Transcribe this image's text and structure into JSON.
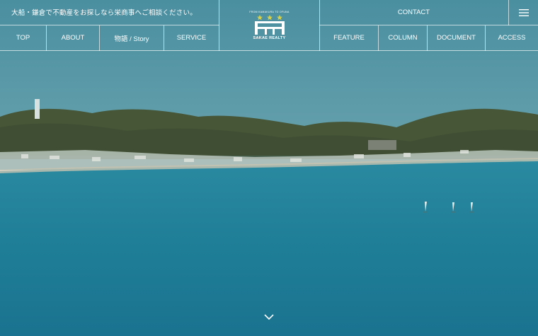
{
  "header": {
    "tagline": "大船・鎌倉で不動産をお探しなら栄商事へご相談ください。",
    "contact_label": "CONTACT",
    "nav_left": [
      {
        "label": "TOP"
      },
      {
        "label": "ABOUT"
      },
      {
        "label": "物語 / Story"
      },
      {
        "label": "SERVICE"
      }
    ],
    "nav_right": [
      {
        "label": "FEATURE"
      },
      {
        "label": "COLUMN"
      },
      {
        "label": "DOCUMENT"
      },
      {
        "label": "ACCESS"
      }
    ]
  },
  "logo": {
    "top_text": "FROM KAMAKURA TO OFUNA",
    "name": "SAKAE REALTY",
    "icon": "sakae-building-logo"
  },
  "icons": {
    "menu": "hamburger-menu-icon",
    "scroll": "chevron-down-icon"
  },
  "colors": {
    "sky": "#4f93a0",
    "sea": "#1f7f96",
    "hills": "#4b5a3a",
    "accent_stars": "#d8d24a"
  }
}
